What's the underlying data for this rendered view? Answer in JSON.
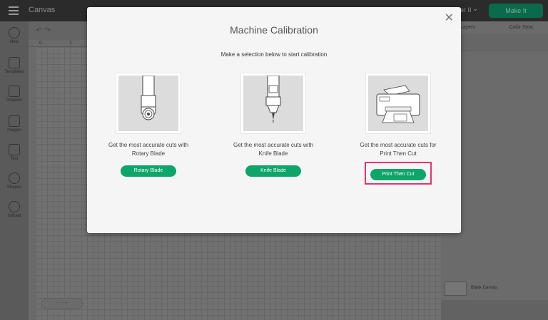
{
  "topbar": {
    "title": "Canvas",
    "machine_label": "er II",
    "make_button": "Make It"
  },
  "sidebar": {
    "items": [
      {
        "label": "New",
        "icon": "plus-icon"
      },
      {
        "label": "Templates",
        "icon": "shirt-icon"
      },
      {
        "label": "Projects",
        "icon": "book-icon"
      },
      {
        "label": "Images",
        "icon": "image-icon"
      },
      {
        "label": "Text",
        "icon": "text-icon"
      },
      {
        "label": "Shapes",
        "icon": "shapes-icon"
      },
      {
        "label": "Upload",
        "icon": "upload-icon"
      }
    ]
  },
  "ruler": {
    "marks": [
      "0",
      "1"
    ]
  },
  "right_panel": {
    "tabs": [
      "Layers",
      "Color Sync"
    ],
    "blank_canvas_label": "Blank Canvas"
  },
  "modal": {
    "title": "Machine Calibration",
    "subtitle": "Make a selection below to start calibration",
    "close_icon": "close-icon",
    "options": [
      {
        "description_line1": "Get the most accurate cuts with",
        "description_line2": "Rotary Blade",
        "button": "Rotary Blade",
        "icon": "rotary-blade-icon"
      },
      {
        "description_line1": "Get the most accurate cuts with",
        "description_line2": "Knife Blade",
        "button": "Knife Blade",
        "icon": "knife-blade-icon"
      },
      {
        "description_line1": "Get the most accurate cuts for",
        "description_line2": "Print Then Cut",
        "button": "Print Then Cut",
        "icon": "printer-icon",
        "highlighted": true
      }
    ]
  },
  "colors": {
    "accent": "#0ea56a",
    "highlight": "#e2356b"
  }
}
